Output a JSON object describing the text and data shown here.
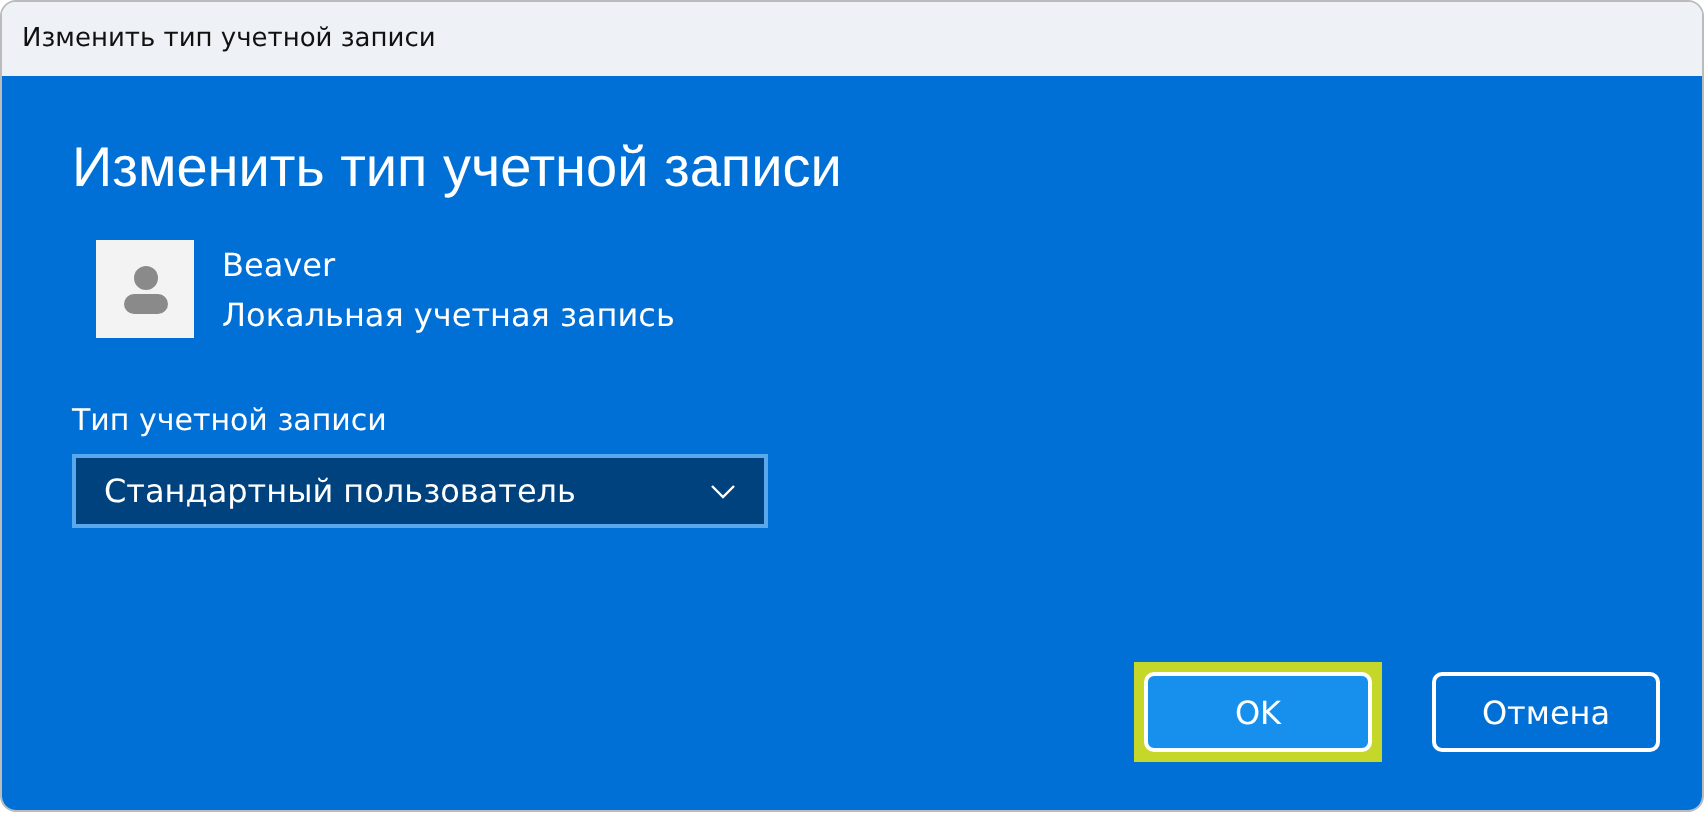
{
  "window": {
    "title": "Изменить тип учетной записи"
  },
  "heading": "Изменить тип учетной записи",
  "account": {
    "name": "Beaver",
    "type": "Локальная учетная запись"
  },
  "account_type": {
    "label": "Тип учетной записи",
    "value": "Стандартный пользователь"
  },
  "buttons": [
    {
      "label": "OK",
      "kind": "primary",
      "highlighted": true
    },
    {
      "label": "Отмена",
      "kind": "secondary",
      "highlighted": false
    }
  ]
}
